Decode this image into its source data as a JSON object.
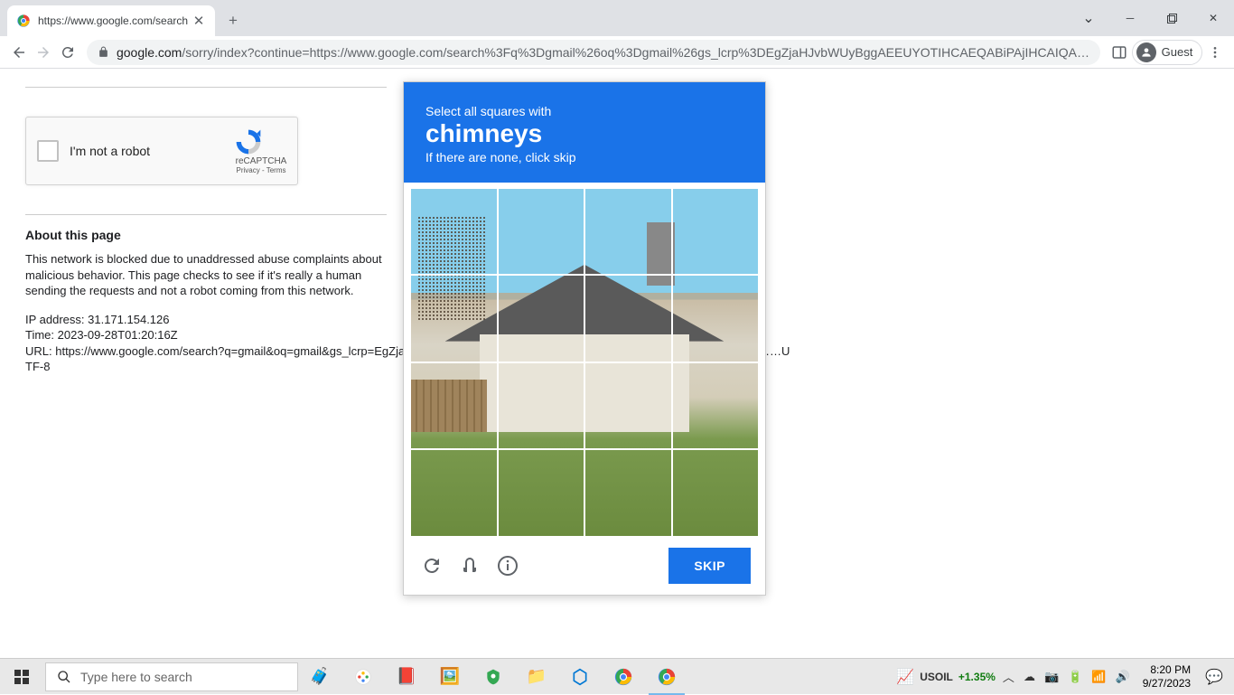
{
  "browser": {
    "tab_title": "https://www.google.com/search",
    "url_display_domain": "google.com",
    "url_display_path": "/sorry/index?continue=https://www.google.com/search%3Fq%3Dgmail%26oq%3Dgmail%26gs_lcrp%3DEgZjaHJvbWUyBggAEEUYOTIHCAEQABiPAjIHCAIQA…",
    "guest_label": "Guest"
  },
  "recaptcha": {
    "checkbox_label": "I'm not a robot",
    "brand": "reCAPTCHA",
    "privacy": "Privacy",
    "terms": "Terms"
  },
  "about": {
    "heading": "About this page",
    "body": "This network is blocked due to unaddressed abuse complaints about malicious behavior. This page checks to see if it's really a human sending the requests and not a robot coming from this network.",
    "ip_line": "IP address: 31.171.154.126",
    "time_line": "Time: 2023-09-28T01:20:16Z",
    "url_line": "URL: https://www.google.com/search?q=gmail&oq=gmail&gs_lcrp=EgZjaHJvbWUyBggAEEUYOTIHCAEQABiP………………………………………UTF-8"
  },
  "challenge": {
    "instruction": "Select all squares with",
    "target": "chimneys",
    "hint": "If there are none, click skip",
    "skip_label": "SKIP"
  },
  "taskbar": {
    "search_placeholder": "Type here to search",
    "ticker_symbol": "USOIL",
    "ticker_change": "+1.35%",
    "time": "8:20 PM",
    "date": "9/27/2023"
  }
}
